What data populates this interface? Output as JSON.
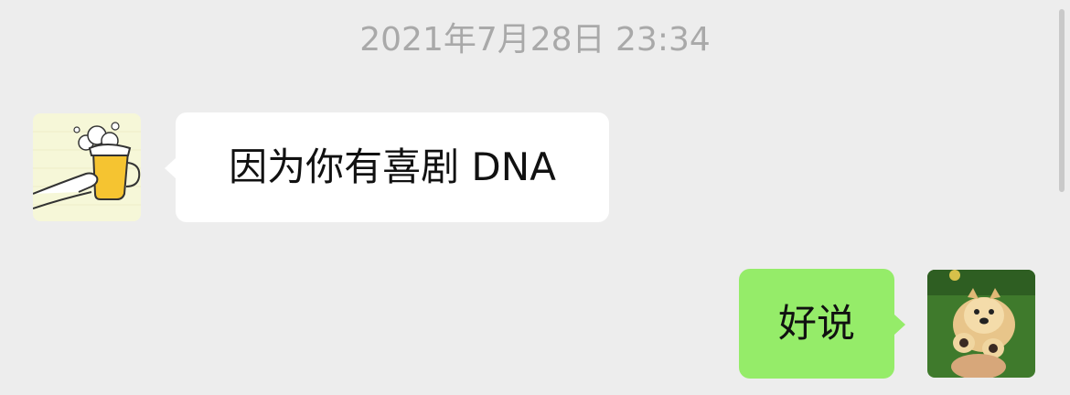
{
  "chat": {
    "timestamp": "2021年7月28日 23:34",
    "messages": [
      {
        "direction": "incoming",
        "text": "因为你有喜剧 DNA",
        "avatar_icon": "beer-mug-avatar-icon"
      },
      {
        "direction": "outgoing",
        "text": "好说",
        "avatar_icon": "chow-chow-dog-avatar-icon"
      }
    ]
  },
  "colors": {
    "background": "#ededed",
    "incoming_bubble": "#ffffff",
    "outgoing_bubble": "#95ec69",
    "timestamp_text": "#a9a9a9"
  }
}
